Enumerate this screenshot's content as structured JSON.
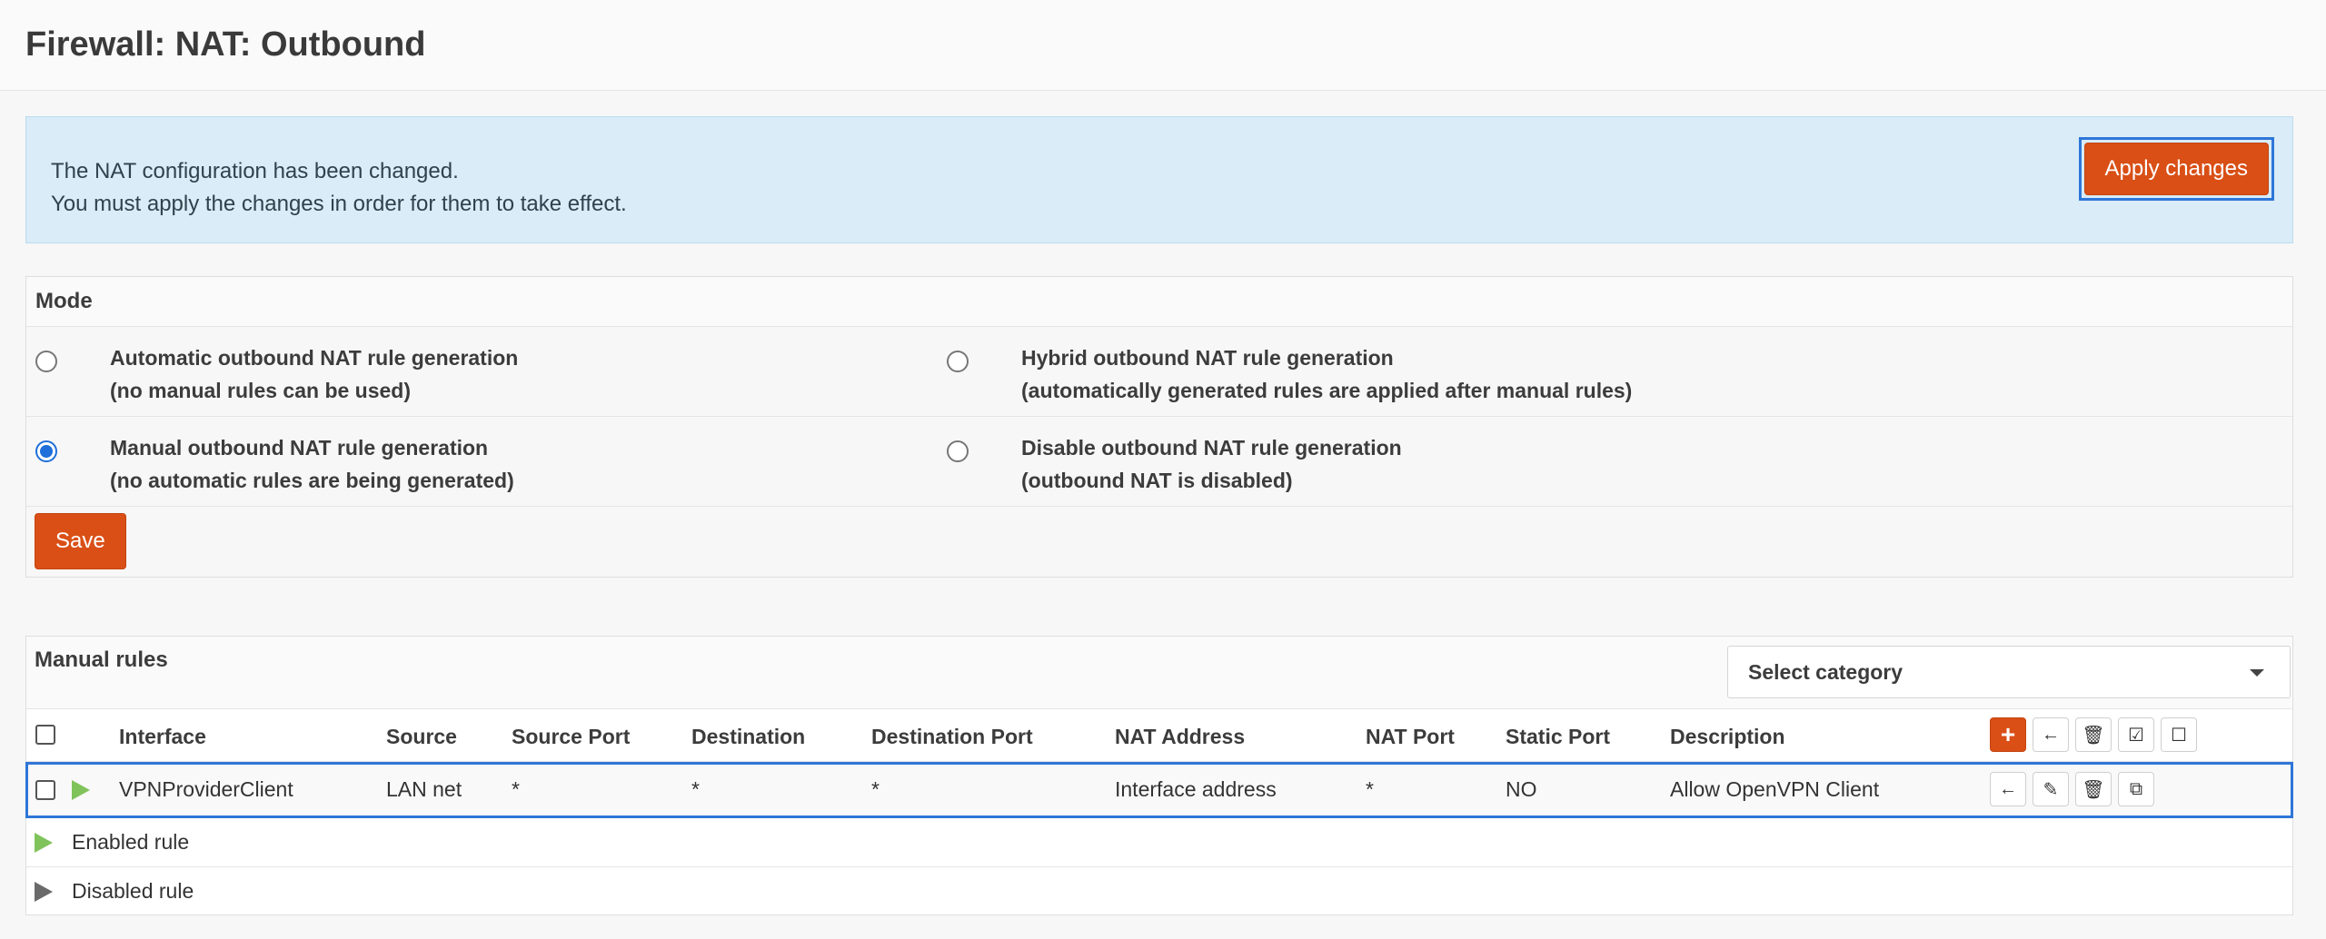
{
  "page": {
    "title": "Firewall: NAT: Outbound"
  },
  "alert": {
    "line1": "The NAT configuration has been changed.",
    "line2": "You must apply the changes in order for them to take effect.",
    "apply_label": "Apply changes"
  },
  "mode": {
    "heading": "Mode",
    "options": [
      {
        "line1": "Automatic outbound NAT rule generation",
        "line2": "(no manual rules can be used)",
        "checked": false
      },
      {
        "line1": "Hybrid outbound NAT rule generation",
        "line2": "(automatically generated rules are applied after manual rules)",
        "checked": false
      },
      {
        "line1": "Manual outbound NAT rule generation",
        "line2": "(no automatic rules are being generated)",
        "checked": true
      },
      {
        "line1": "Disable outbound NAT rule generation",
        "line2": "(outbound NAT is disabled)",
        "checked": false
      }
    ],
    "save_label": "Save"
  },
  "rules": {
    "title": "Manual rules",
    "category_placeholder": "Select category",
    "columns": [
      "Interface",
      "Source",
      "Source Port",
      "Destination",
      "Destination Port",
      "NAT Address",
      "NAT Port",
      "Static Port",
      "Description"
    ],
    "rows": [
      {
        "interface": "VPNProviderClient",
        "source": "LAN net",
        "source_port": "*",
        "destination": "*",
        "destination_port": "*",
        "nat_address": "Interface address",
        "nat_port": "*",
        "static_port": "NO",
        "description": "Allow OpenVPN Client",
        "enabled": true
      }
    ],
    "legend": {
      "enabled": "Enabled rule",
      "disabled": "Disabled rule"
    }
  },
  "colors": {
    "accent": "#d94f16",
    "focus": "#2f76d8",
    "enabled": "#80c35b",
    "alert_bg": "#d9ecf7"
  }
}
